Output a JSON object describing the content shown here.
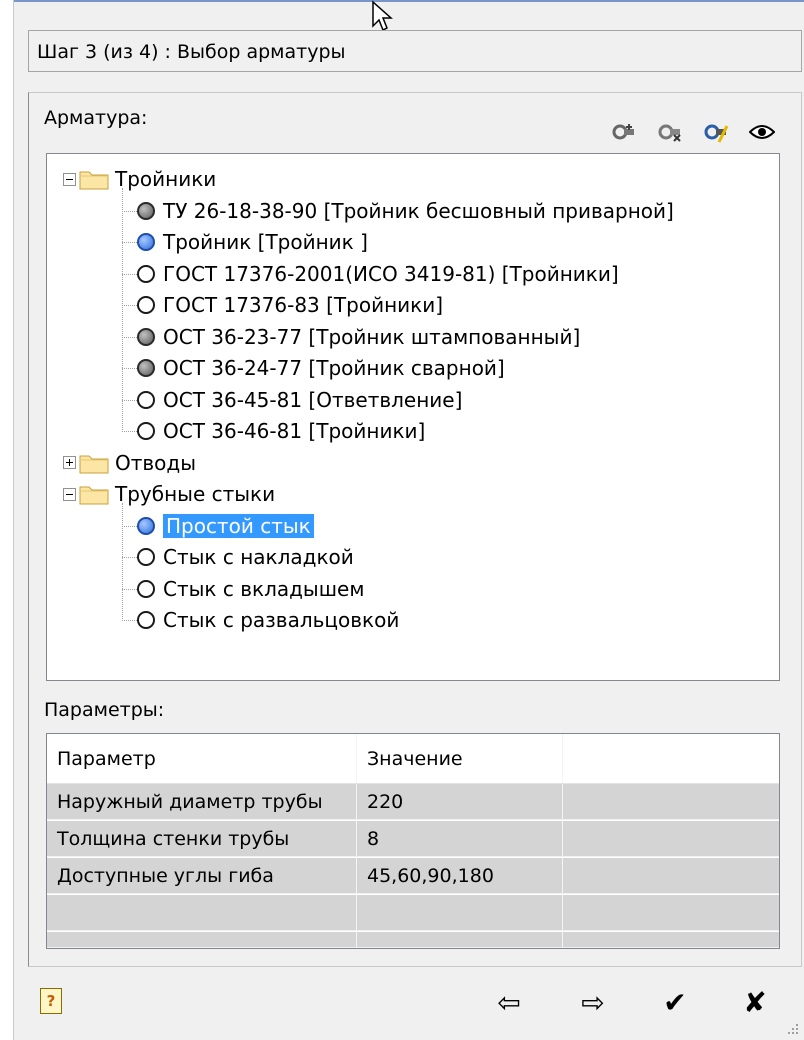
{
  "step": {
    "text": "Шаг 3 (из 4) : Выбор арматуры"
  },
  "armature": {
    "label": "Арматура:",
    "toolbar": [
      {
        "icon": "add-fitting-icon"
      },
      {
        "icon": "remove-fitting-icon"
      },
      {
        "icon": "edit-fitting-icon"
      },
      {
        "icon": "view-icon"
      }
    ]
  },
  "tree": {
    "groups": [
      {
        "label": "Тройники",
        "expanded": true,
        "items": [
          {
            "label": "ТУ 26-18-38-90 [Тройник бесшовный приварной]",
            "state": "gray"
          },
          {
            "label": "Тройник [Тройник ]",
            "state": "blue"
          },
          {
            "label": "ГОСТ 17376-2001(ИСО 3419-81) [Тройники]",
            "state": "white"
          },
          {
            "label": "ГОСТ 17376-83 [Тройники]",
            "state": "white"
          },
          {
            "label": "ОСТ 36-23-77 [Тройник штампованный]",
            "state": "gray"
          },
          {
            "label": "ОСТ 36-24-77 [Тройник сварной]",
            "state": "gray"
          },
          {
            "label": "ОСТ 36-45-81 [Ответвление]",
            "state": "white"
          },
          {
            "label": "ОСТ 36-46-81 [Тройники]",
            "state": "white"
          }
        ]
      },
      {
        "label": "Отводы",
        "expanded": false,
        "items": []
      },
      {
        "label": "Трубные стыки",
        "expanded": true,
        "items": [
          {
            "label": "Простой стык",
            "state": "blue",
            "selected": true
          },
          {
            "label": "Стык с накладкой",
            "state": "white"
          },
          {
            "label": "Стык с вкладышем",
            "state": "white"
          },
          {
            "label": "Стык с развальцовкой",
            "state": "white"
          }
        ]
      }
    ]
  },
  "params": {
    "label": "Параметры:",
    "columns": [
      "Параметр",
      "Значение",
      ""
    ],
    "rows": [
      [
        "Наружный диаметр трубы",
        "220",
        ""
      ],
      [
        "Толщина стенки трубы",
        "8",
        ""
      ],
      [
        "Доступные углы гиба",
        "45,60,90,180",
        ""
      ],
      [
        "",
        "",
        ""
      ],
      [
        "",
        "",
        ""
      ]
    ]
  },
  "footer": {
    "help_icon": "help-icon",
    "buttons": [
      {
        "icon": "back-arrow-icon",
        "glyph": "⇦"
      },
      {
        "icon": "forward-arrow-icon",
        "glyph": "⇨"
      },
      {
        "icon": "checkmark-icon",
        "glyph": "✔"
      },
      {
        "icon": "cancel-icon",
        "glyph": "✘"
      }
    ]
  }
}
